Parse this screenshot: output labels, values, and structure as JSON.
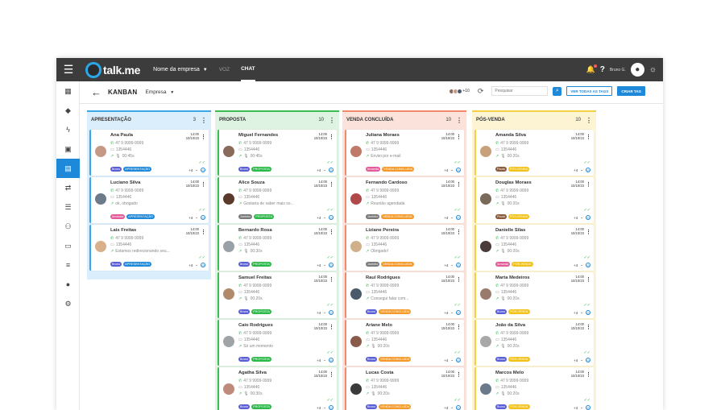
{
  "topbar": {
    "logo_text": "talk.me",
    "company_label": "Nome da empresa",
    "tabs": [
      {
        "label": "VOZ"
      },
      {
        "label": "CHAT"
      }
    ],
    "username": "Bruno G."
  },
  "header": {
    "title": "KANBAN",
    "company_filter": "Empresa",
    "avatars_more": "+10",
    "search_placeholder": "Pesquisar",
    "see_all_tags": "VER TODAS AS TAGS",
    "create_tag": "CRIAR TAG"
  },
  "colors": {
    "accent": "#1e88d9",
    "topbar": "#3c3c3c",
    "tag_bruno": "#5b5fd6",
    "tag_juninho": "#7a7a7a",
    "tag_amanda": "#e45b9a",
    "tag_paula": "#8a5a3c"
  },
  "columns": [
    {
      "name": "APRESENTAÇÃO",
      "count": "3",
      "bg": "#dbeefb",
      "border": "#3aa8e8",
      "tag_color": "#1e88d9",
      "cards": [
        {
          "name": "Ana Paula",
          "time": "14:00",
          "date": "10/10/23",
          "phone": "47 9 9999-9999",
          "id": "1354446",
          "last": "00:45s",
          "last_icon": "mic",
          "owner": "Bruno",
          "owner_color": "#5b5fd6",
          "tag": "APRESENTAÇÃO",
          "more": "+4",
          "avatar": "#c49a86"
        },
        {
          "name": "Luciano Silva",
          "time": "14:00",
          "date": "10/10/23",
          "phone": "47 9 9999-9999",
          "id": "1354446",
          "last": "ok, obrigado",
          "last_icon": "msg",
          "owner": "Amanda",
          "owner_color": "#e45b9a",
          "tag": "APRESENTAÇÃO",
          "more": "+4",
          "avatar": "#6c7a8a"
        },
        {
          "name": "Lais Freitas",
          "time": "14:00",
          "date": "10/10/23",
          "phone": "47 9 9999-9999",
          "id": "1354446",
          "last": "Estamos redirecionando seu...",
          "last_icon": "msg",
          "owner": "Bruno",
          "owner_color": "#5b5fd6",
          "tag": "APRESENTAÇÃO",
          "more": "+4",
          "avatar": "#d8b08c"
        }
      ]
    },
    {
      "name": "PROPOSTA",
      "count": "10",
      "bg": "#dff3e2",
      "border": "#3dbb55",
      "tag_color": "#2db84a",
      "cards": [
        {
          "name": "Miguel Fernandes",
          "time": "14:00",
          "date": "10/10/23",
          "phone": "47 9 9999-9999",
          "id": "1354446",
          "last": "00:45s",
          "last_icon": "mic",
          "owner": "Bruno",
          "owner_color": "#5b5fd6",
          "tag": "PROPOSTA",
          "more": "+4",
          "avatar": "#8a6a5a"
        },
        {
          "name": "Alice Souza",
          "time": "14:00",
          "date": "10/10/23",
          "phone": "47 9 9999-9999",
          "id": "1354446",
          "last": "Gostaria de saber mais so...",
          "last_icon": "msg",
          "owner": "Juninho",
          "owner_color": "#7a7a7a",
          "tag": "PROPOSTA",
          "more": "+4",
          "avatar": "#5a3a2a"
        },
        {
          "name": "Bernardo Rosa",
          "time": "14:00",
          "date": "10/10/23",
          "phone": "47 9 9999-9999",
          "id": "1354446",
          "last": "00:30s",
          "last_icon": "mic",
          "owner": "Bruno",
          "owner_color": "#5b5fd6",
          "tag": "PROPOSTA",
          "more": "+4",
          "avatar": "#9aa0a8"
        },
        {
          "name": "Samuel Freitas",
          "time": "14:00",
          "date": "10/10/23",
          "phone": "47 9 9999-9999",
          "id": "1354446",
          "last": "00:20s",
          "last_icon": "mic",
          "owner": "Bruno",
          "owner_color": "#5b5fd6",
          "tag": "PROPOSTA",
          "more": "+4",
          "avatar": "#b08a6a"
        },
        {
          "name": "Caio Rodrigues",
          "time": "14:00",
          "date": "10/10/23",
          "phone": "47 9 9999-9999",
          "id": "1354446",
          "last": "Só um momento",
          "last_icon": "msg",
          "owner": "Bruno",
          "owner_color": "#5b5fd6",
          "tag": "PROPOSTA",
          "more": "+4",
          "avatar": "#a0a4a8"
        },
        {
          "name": "Agatha Silva",
          "time": "14:00",
          "date": "10/10/23",
          "phone": "47 9 9999-9999",
          "id": "1354446",
          "last": "00:30s",
          "last_icon": "mic",
          "owner": "Bruno",
          "owner_color": "#5b5fd6",
          "tag": "PROPOSTA",
          "more": "+4",
          "avatar": "#c08a7a"
        }
      ]
    },
    {
      "name": "VENDA CONCLUÍDA",
      "count": "10",
      "bg": "#fbe3dc",
      "border": "#f08a6a",
      "tag_color": "#f39a2a",
      "cards": [
        {
          "name": "Juliana Moraes",
          "time": "14:00",
          "date": "10/10/23",
          "phone": "47 9 9999-9999",
          "id": "1354446",
          "last": "Enviei por e-mail",
          "last_icon": "msg",
          "owner": "Amanda",
          "owner_color": "#e45b9a",
          "tag": "VENDA CONCLUÍDA",
          "more": "+4",
          "avatar": "#c07a6a"
        },
        {
          "name": "Fernando Cardoso",
          "time": "14:00",
          "date": "10/10/23",
          "phone": "47 9 9999-9999",
          "id": "1354446",
          "last": "Reunião agendada",
          "last_icon": "msg",
          "owner": "Juninho",
          "owner_color": "#7a7a7a",
          "tag": "VENDA CONCLUÍDA",
          "more": "+4",
          "avatar": "#b04a4a"
        },
        {
          "name": "Liziane Pereira",
          "time": "14:00",
          "date": "10/10/23",
          "phone": "47 9 9999-9999",
          "id": "1354446",
          "last": "Obrigado!",
          "last_icon": "msg",
          "owner": "Juninho",
          "owner_color": "#7a7a7a",
          "tag": "VENDA CONCLUÍDA",
          "more": "+4",
          "avatar": "#d0b08a"
        },
        {
          "name": "Raul Rodrigues",
          "time": "14:00",
          "date": "10/10/23",
          "phone": "47 9 9999-9999",
          "id": "1354446",
          "last": "Consegui falar com...",
          "last_icon": "msg",
          "owner": "Bruno",
          "owner_color": "#5b5fd6",
          "tag": "VENDA CONCLUÍDA",
          "more": "+4",
          "avatar": "#4a5a6a"
        },
        {
          "name": "Ariane Melo",
          "time": "14:00",
          "date": "10/10/23",
          "phone": "47 9 9999-9999",
          "id": "1354446",
          "last": "00:20s",
          "last_icon": "mic",
          "owner": "Bruno",
          "owner_color": "#5b5fd6",
          "tag": "VENDA CONCLUÍDA",
          "more": "+4",
          "avatar": "#8a5a4a"
        },
        {
          "name": "Lucas Costa",
          "time": "14:00",
          "date": "10/10/23",
          "phone": "47 9 9999-9999",
          "id": "1354446",
          "last": "00:20s",
          "last_icon": "mic",
          "owner": "Bruno",
          "owner_color": "#5b5fd6",
          "tag": "VENDA CONCLUÍDA",
          "more": "+4",
          "avatar": "#3a3a3a"
        }
      ]
    },
    {
      "name": "PÓS-VENDA",
      "count": "10",
      "bg": "#fcf4d2",
      "border": "#f2d04a",
      "tag_color": "#f2c21c",
      "cards": [
        {
          "name": "Amanda Silva",
          "time": "14:00",
          "date": "10/10/23",
          "phone": "47 9 9999-9999",
          "id": "1354446",
          "last": "00:20s",
          "last_icon": "mic",
          "owner": "Paula",
          "owner_color": "#8a5a3c",
          "tag": "PÓS-VENDA",
          "more": "+4",
          "avatar": "#c8a07a"
        },
        {
          "name": "Douglas Moraes",
          "time": "14:00",
          "date": "10/10/23",
          "phone": "47 9 9999-9999",
          "id": "1354446",
          "last": "00:20s",
          "last_icon": "mic",
          "owner": "Paula",
          "owner_color": "#8a5a3c",
          "tag": "PÓS-VENDA",
          "more": "+4",
          "avatar": "#7a6a5a"
        },
        {
          "name": "Danielle Silas",
          "time": "14:00",
          "date": "10/10/23",
          "phone": "47 9 9999-9999",
          "id": "1354446",
          "last": "00:20s",
          "last_icon": "mic",
          "owner": "Amanda",
          "owner_color": "#e45b9a",
          "tag": "PÓS-VENDA",
          "more": "+4",
          "avatar": "#4a3a3a"
        },
        {
          "name": "Marta Medeiros",
          "time": "14:00",
          "date": "10/10/23",
          "phone": "47 9 9999-9999",
          "id": "1354446",
          "last": "00:20s",
          "last_icon": "mic",
          "owner": "Bruno",
          "owner_color": "#5b5fd6",
          "tag": "PÓS-VENDA",
          "more": "+4",
          "avatar": "#9a7a6a"
        },
        {
          "name": "João da Silva",
          "time": "14:00",
          "date": "10/10/23",
          "phone": "47 9 9999-9999",
          "id": "1354446",
          "last": "00:20s",
          "last_icon": "mic",
          "owner": "Bruno",
          "owner_color": "#5b5fd6",
          "tag": "PÓS-VENDA",
          "more": "+4",
          "avatar": "#a8a8a8"
        },
        {
          "name": "Marcos Melo",
          "time": "14:00",
          "date": "10/10/23",
          "phone": "47 9 9999-9999",
          "id": "1354446",
          "last": "00:20s",
          "last_icon": "mic",
          "owner": "Bruno",
          "owner_color": "#5b5fd6",
          "tag": "PÓS-VENDA",
          "more": "+4",
          "avatar": "#6a7a8a"
        }
      ]
    }
  ],
  "sidebar": {
    "items": [
      {
        "icon": "dashboard-icon",
        "glyph": "▦"
      },
      {
        "icon": "tag-icon",
        "glyph": "◆"
      },
      {
        "icon": "lightning-icon",
        "glyph": "ϟ"
      },
      {
        "icon": "contact-icon",
        "glyph": "▣"
      },
      {
        "icon": "kanban-icon",
        "glyph": "▤",
        "active": true
      },
      {
        "icon": "routing-icon",
        "glyph": "⇄"
      },
      {
        "icon": "list-icon",
        "glyph": "☰"
      },
      {
        "icon": "group-icon",
        "glyph": "⚇"
      },
      {
        "icon": "chat-icon",
        "glyph": "▭"
      },
      {
        "icon": "filter-icon",
        "glyph": "≡"
      },
      {
        "icon": "user-icon",
        "glyph": "●"
      },
      {
        "icon": "settings-icon",
        "glyph": "⚙"
      }
    ]
  }
}
